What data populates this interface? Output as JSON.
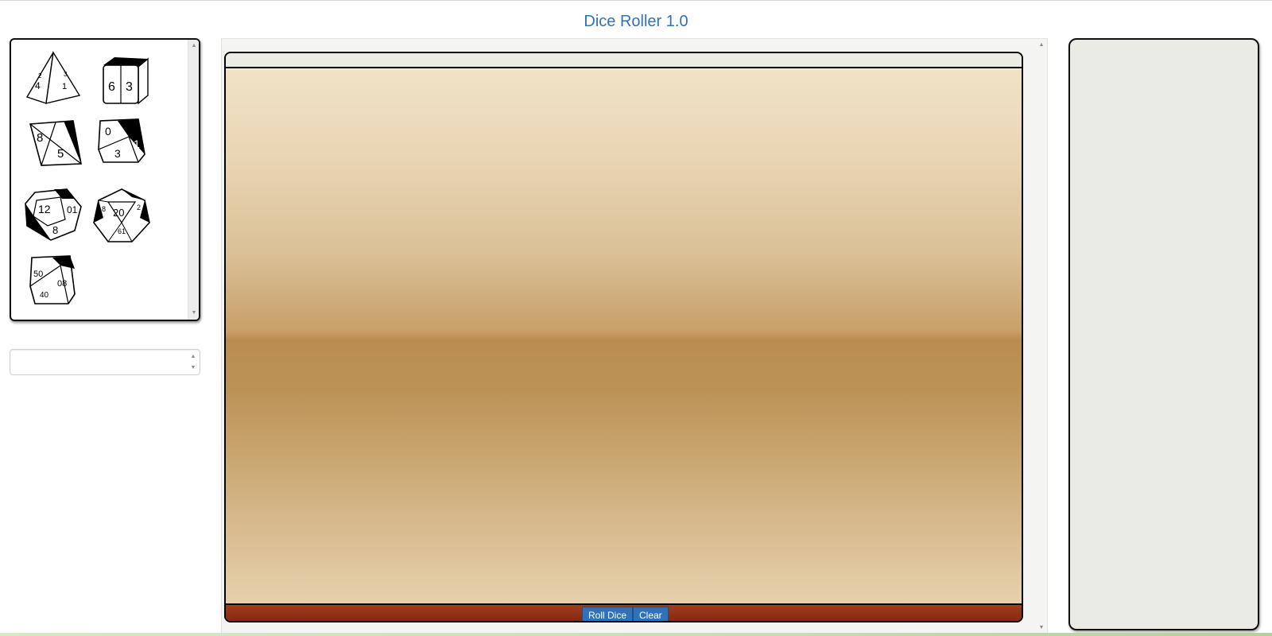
{
  "app": {
    "title": "Dice Roller 1.0"
  },
  "dice_palette": {
    "dice": [
      {
        "name": "d4",
        "icon": "d4-die-icon"
      },
      {
        "name": "d6",
        "icon": "d6-die-icon"
      },
      {
        "name": "d8",
        "icon": "d8-die-icon"
      },
      {
        "name": "d10",
        "icon": "d10-die-icon"
      },
      {
        "name": "d12",
        "icon": "d12-die-icon"
      },
      {
        "name": "d20",
        "icon": "d20-die-icon"
      },
      {
        "name": "d100",
        "icon": "d100-die-icon"
      }
    ]
  },
  "expression_input": {
    "value": "",
    "placeholder": ""
  },
  "dice_table": {
    "roll_button": "Roll Dice",
    "clear_button": "Clear"
  },
  "colors": {
    "title": "#2f72b8",
    "button": "#2f72b8",
    "table_footer": "#8a3016",
    "results_panel": "#ebebe5"
  }
}
